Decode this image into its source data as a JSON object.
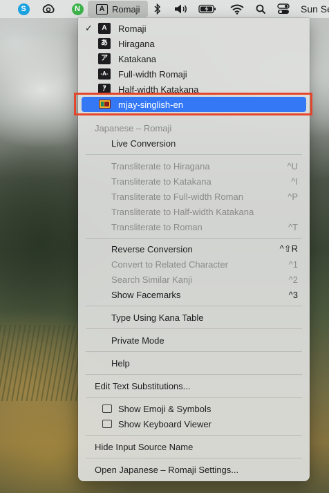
{
  "menubar": {
    "icons": [
      "skype-icon",
      "creative-cloud-icon",
      "notes-n-icon",
      "bluetooth-icon",
      "volume-icon",
      "battery-icon",
      "wifi-icon",
      "search-icon",
      "control-center-icon"
    ],
    "input_source_label": "Romaji",
    "input_source_glyph": "A",
    "clock": "Sun Se"
  },
  "menu": {
    "sources": [
      {
        "glyph": "A",
        "label": "Romaji",
        "checked": true
      },
      {
        "glyph": "あ",
        "label": "Hiragana"
      },
      {
        "glyph": "ア",
        "label": "Katakana"
      },
      {
        "glyph": "-A-",
        "label": "Full-width Romaji"
      },
      {
        "glyph": "ｱ",
        "label": "Half-width Katakana"
      },
      {
        "glyph": "flag",
        "label": "mjay-singlish-en",
        "selected": true
      }
    ],
    "section_header": "Japanese – Romaji",
    "live_conversion": "Live Conversion",
    "transliterate": [
      {
        "label": "Transliterate to Hiragana",
        "shortcut": "^U"
      },
      {
        "label": "Transliterate to Katakana",
        "shortcut": "^I"
      },
      {
        "label": "Transliterate to Full-width Roman",
        "shortcut": "^P"
      },
      {
        "label": "Transliterate to Half-width Katakana",
        "shortcut": ""
      },
      {
        "label": "Transliterate to Roman",
        "shortcut": "^T"
      }
    ],
    "reverse_conversion": {
      "label": "Reverse Conversion",
      "shortcut": "^⇧R"
    },
    "convert_related": {
      "label": "Convert to Related Character",
      "shortcut": "^1"
    },
    "search_kanji": {
      "label": "Search Similar Kanji",
      "shortcut": "^2"
    },
    "show_facemarks": {
      "label": "Show Facemarks",
      "shortcut": "^3"
    },
    "kana_table": "Type Using Kana Table",
    "private_mode": "Private Mode",
    "help": "Help",
    "edit_substitutions": "Edit Text Substitutions...",
    "show_emoji": "Show Emoji & Symbols",
    "show_keyboard": "Show Keyboard Viewer",
    "hide_input_source": "Hide Input Source Name",
    "open_settings": "Open Japanese – Romaji Settings..."
  },
  "colors": {
    "selection": "#3478f6",
    "highlight_box": "#e5462b"
  }
}
